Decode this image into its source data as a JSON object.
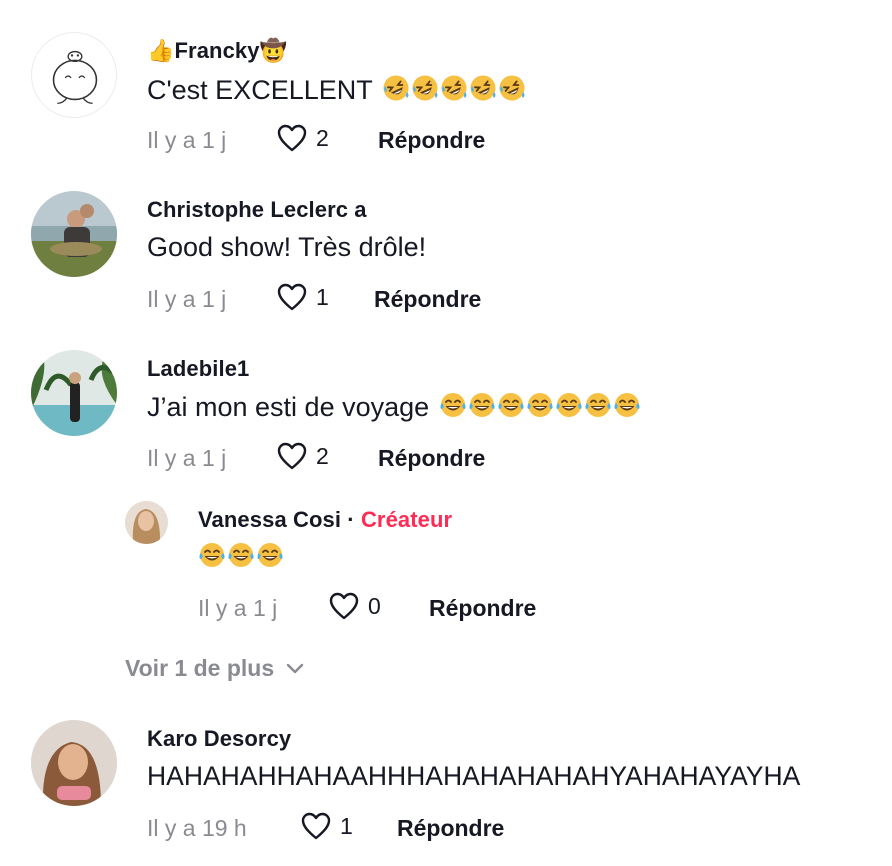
{
  "comments": [
    {
      "username": "👍Francky🤠",
      "text": "C'est EXCELLENT",
      "emoji_count": 5,
      "emoji": "rofl",
      "time": "Il y a 1 j",
      "likes": "2",
      "reply_label": "Répondre"
    },
    {
      "username": "Christophe Leclerc a",
      "text": "Good show! Très drôle!",
      "time": "Il y a 1 j",
      "likes": "1",
      "reply_label": "Répondre"
    },
    {
      "username": "Ladebile1",
      "text": "J’ai mon esti de voyage",
      "emoji_count": 7,
      "emoji": "joy",
      "time": "Il y a 1 j",
      "likes": "2",
      "reply_label": "Répondre"
    },
    {
      "username": "Vanessa Cosi",
      "separator": "·",
      "creator_label": "Créateur",
      "text": "",
      "emoji_count": 3,
      "emoji": "joy",
      "time": "Il y a 1 j",
      "likes": "0",
      "reply_label": "Répondre"
    },
    {
      "username": "Karo Desorcy",
      "text": "HAHAHAHHAHAAHHHAHAHAHAHAHYAHAHAYAYHA",
      "time": "Il y a 19 h",
      "likes": "1",
      "reply_label": "Répondre"
    }
  ],
  "view_more": {
    "label": "Voir 1 de plus"
  },
  "colors": {
    "text": "#161823",
    "muted": "#8a8b91",
    "creator": "#fe2c55"
  }
}
